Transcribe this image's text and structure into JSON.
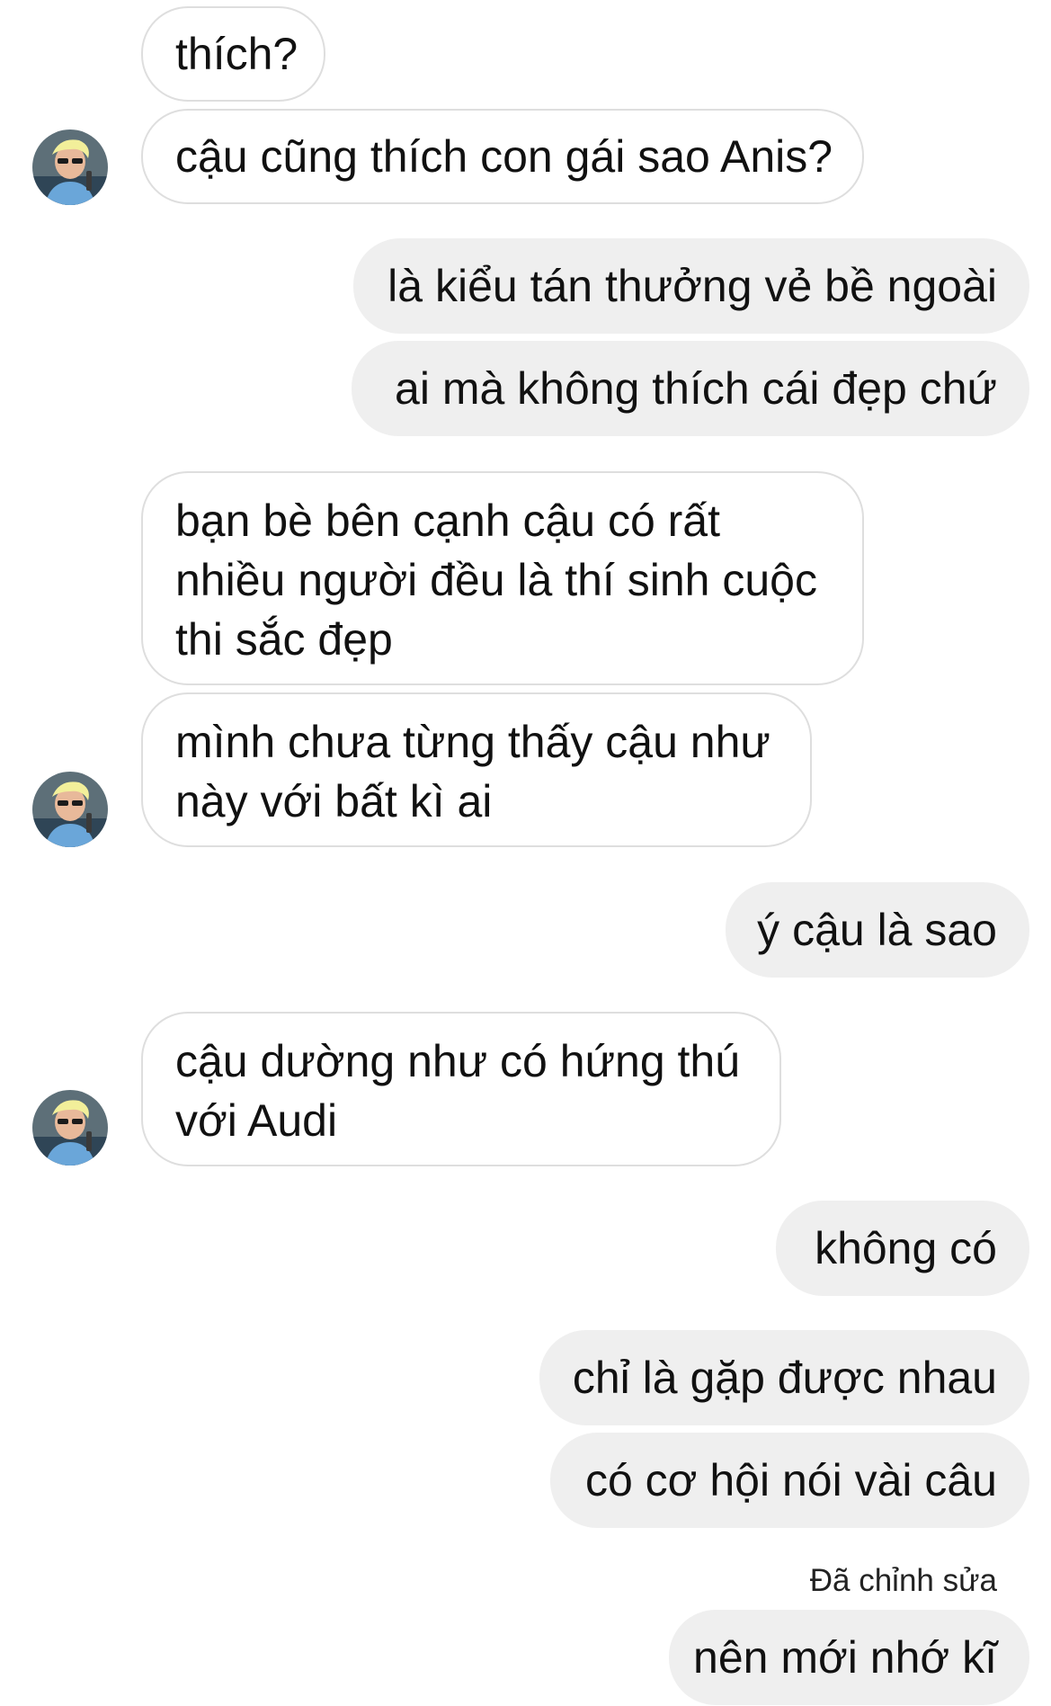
{
  "messages": [
    {
      "id": "m1",
      "side": "in",
      "text": "thích?"
    },
    {
      "id": "m2",
      "side": "in",
      "text": "cậu cũng thích con gái sao Anis?"
    },
    {
      "id": "m3",
      "side": "out",
      "text": "là kiểu tán thưởng vẻ bề ngoài"
    },
    {
      "id": "m4",
      "side": "out",
      "text": "ai mà không thích cái đẹp chứ"
    },
    {
      "id": "m5",
      "side": "in",
      "text": "bạn bè bên cạnh cậu có rất nhiều người đều là thí sinh cuộc thi sắc đẹp"
    },
    {
      "id": "m6",
      "side": "in",
      "text": "mình chưa từng thấy cậu như này với bất kì ai"
    },
    {
      "id": "m7",
      "side": "out",
      "text": "ý cậu là sao"
    },
    {
      "id": "m8",
      "side": "in",
      "text": "cậu dường như có hứng thú với Audi"
    },
    {
      "id": "m9",
      "side": "out",
      "text": "không có"
    },
    {
      "id": "m10",
      "side": "out",
      "text": "chỉ là gặp được nhau"
    },
    {
      "id": "m11",
      "side": "out",
      "text": "có cơ hội nói vài câu"
    },
    {
      "id": "m12",
      "side": "out",
      "text": "nên mới nhớ kĩ"
    }
  ],
  "edited_label": "Đã chỉnh sửa",
  "colors": {
    "incoming_bubble_bg": "#ffffff",
    "incoming_bubble_border": "#dedede",
    "outgoing_bubble_bg": "#efefef",
    "text": "#111111"
  },
  "icons": {
    "avatar": "profile-photo-avatar"
  }
}
